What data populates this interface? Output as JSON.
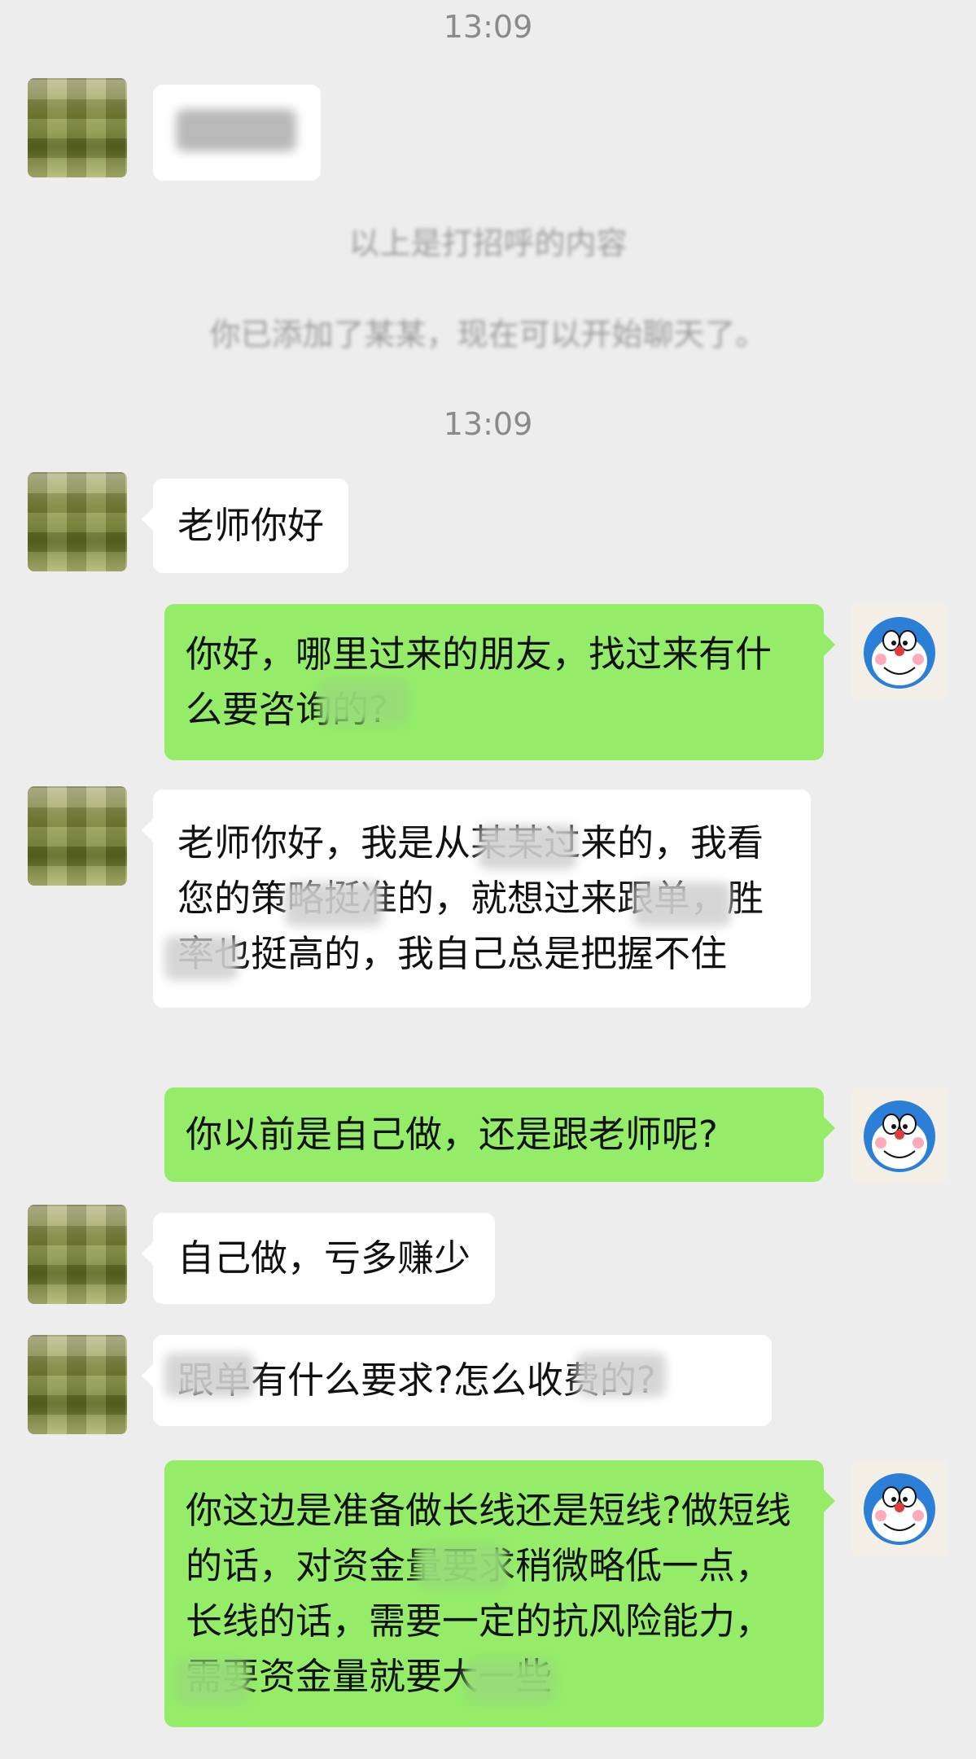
{
  "timestamps": [
    "13:09",
    "13:09"
  ],
  "system_notice": {
    "line1": "以上是打招呼的内容",
    "line2": "你已添加了某某，现在可以开始聊天了。"
  },
  "messages": [
    {
      "side": "left",
      "text": "老师你好"
    },
    {
      "side": "right",
      "text": "你好，哪里过来的朋友，找过来有什么要咨询的?"
    },
    {
      "side": "left",
      "text": "老师你好，我是从某某过来的，我看您的策略挺准的，就想过来跟单，胜率也挺高的，我自己总是把握不住"
    },
    {
      "side": "right",
      "text": "你以前是自己做，还是跟老师呢?"
    },
    {
      "side": "left",
      "text": "自己做，亏多赚少"
    },
    {
      "side": "left",
      "text": "跟单有什么要求?怎么收费的?"
    },
    {
      "side": "right",
      "text": "你这边是准备做长线还是短线?做短线的话，对资金量要求稍微略低一点，长线的话，需要一定的抗风险能力，需要资金量就要大一些"
    }
  ],
  "colors": {
    "background": "#ededed",
    "left_bubble": "#ffffff",
    "right_bubble": "#95ec69",
    "time_text": "#8a8a8a"
  },
  "icons": {
    "left_avatar": "pixelated-avatar-icon",
    "right_avatar": "doraemon-avatar-icon"
  }
}
